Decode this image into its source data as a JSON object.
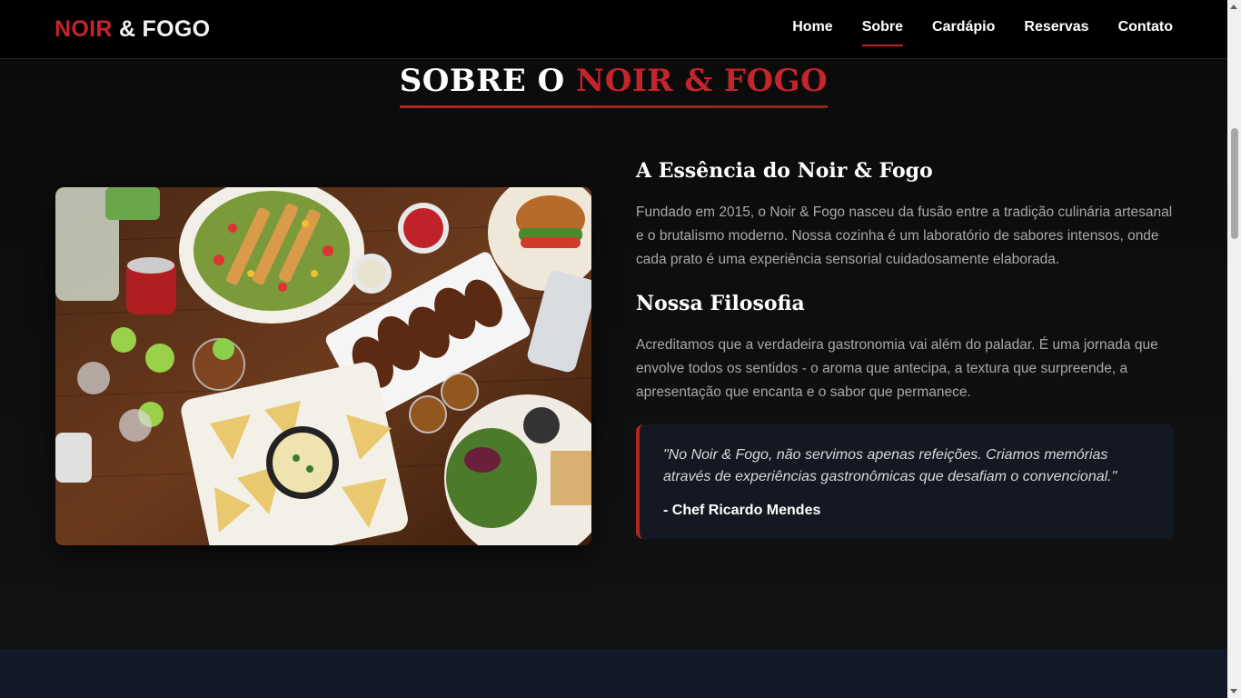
{
  "navbar": {
    "logo_red": "NOIR",
    "logo_white": "& FOGO",
    "links": [
      {
        "label": "Home"
      },
      {
        "label": "Sobre"
      },
      {
        "label": "Cardápio"
      },
      {
        "label": "Reservas"
      },
      {
        "label": "Contato"
      }
    ],
    "active_link": "Sobre"
  },
  "section": {
    "title_white": "SOBRE O",
    "title_red": "NOIR & FOGO"
  },
  "about": {
    "heading1": "A Essência do Noir & Fogo",
    "paragraph1": "Fundado em 2015, o Noir & Fogo nasceu da fusão entre a tradição culinária artesanal e o brutalismo moderno. Nossa cozinha é um laboratório de sabores intensos, onde cada prato é uma experiência sensorial cuidadosamente elaborada.",
    "heading2": "Nossa Filosofia",
    "paragraph2": "Acreditamos que a verdadeira gastronomia vai além do paladar. É uma jornada que envolve todos os sentidos - o aroma que antecipa, a textura que surpreende, a apresentação que encanta e o sabor que permanece.",
    "quote": "\"No Noir & Fogo, não servimos apenas refeições. Criamos memórias através de experiências gastronômicas que desafiam o convencional.\"",
    "quote_author": "- Chef Ricardo Mendes"
  },
  "colors": {
    "accent": "#c2252b",
    "background": "#0c0c0c",
    "quote_background": "#141822",
    "footer_band": "#111827"
  }
}
